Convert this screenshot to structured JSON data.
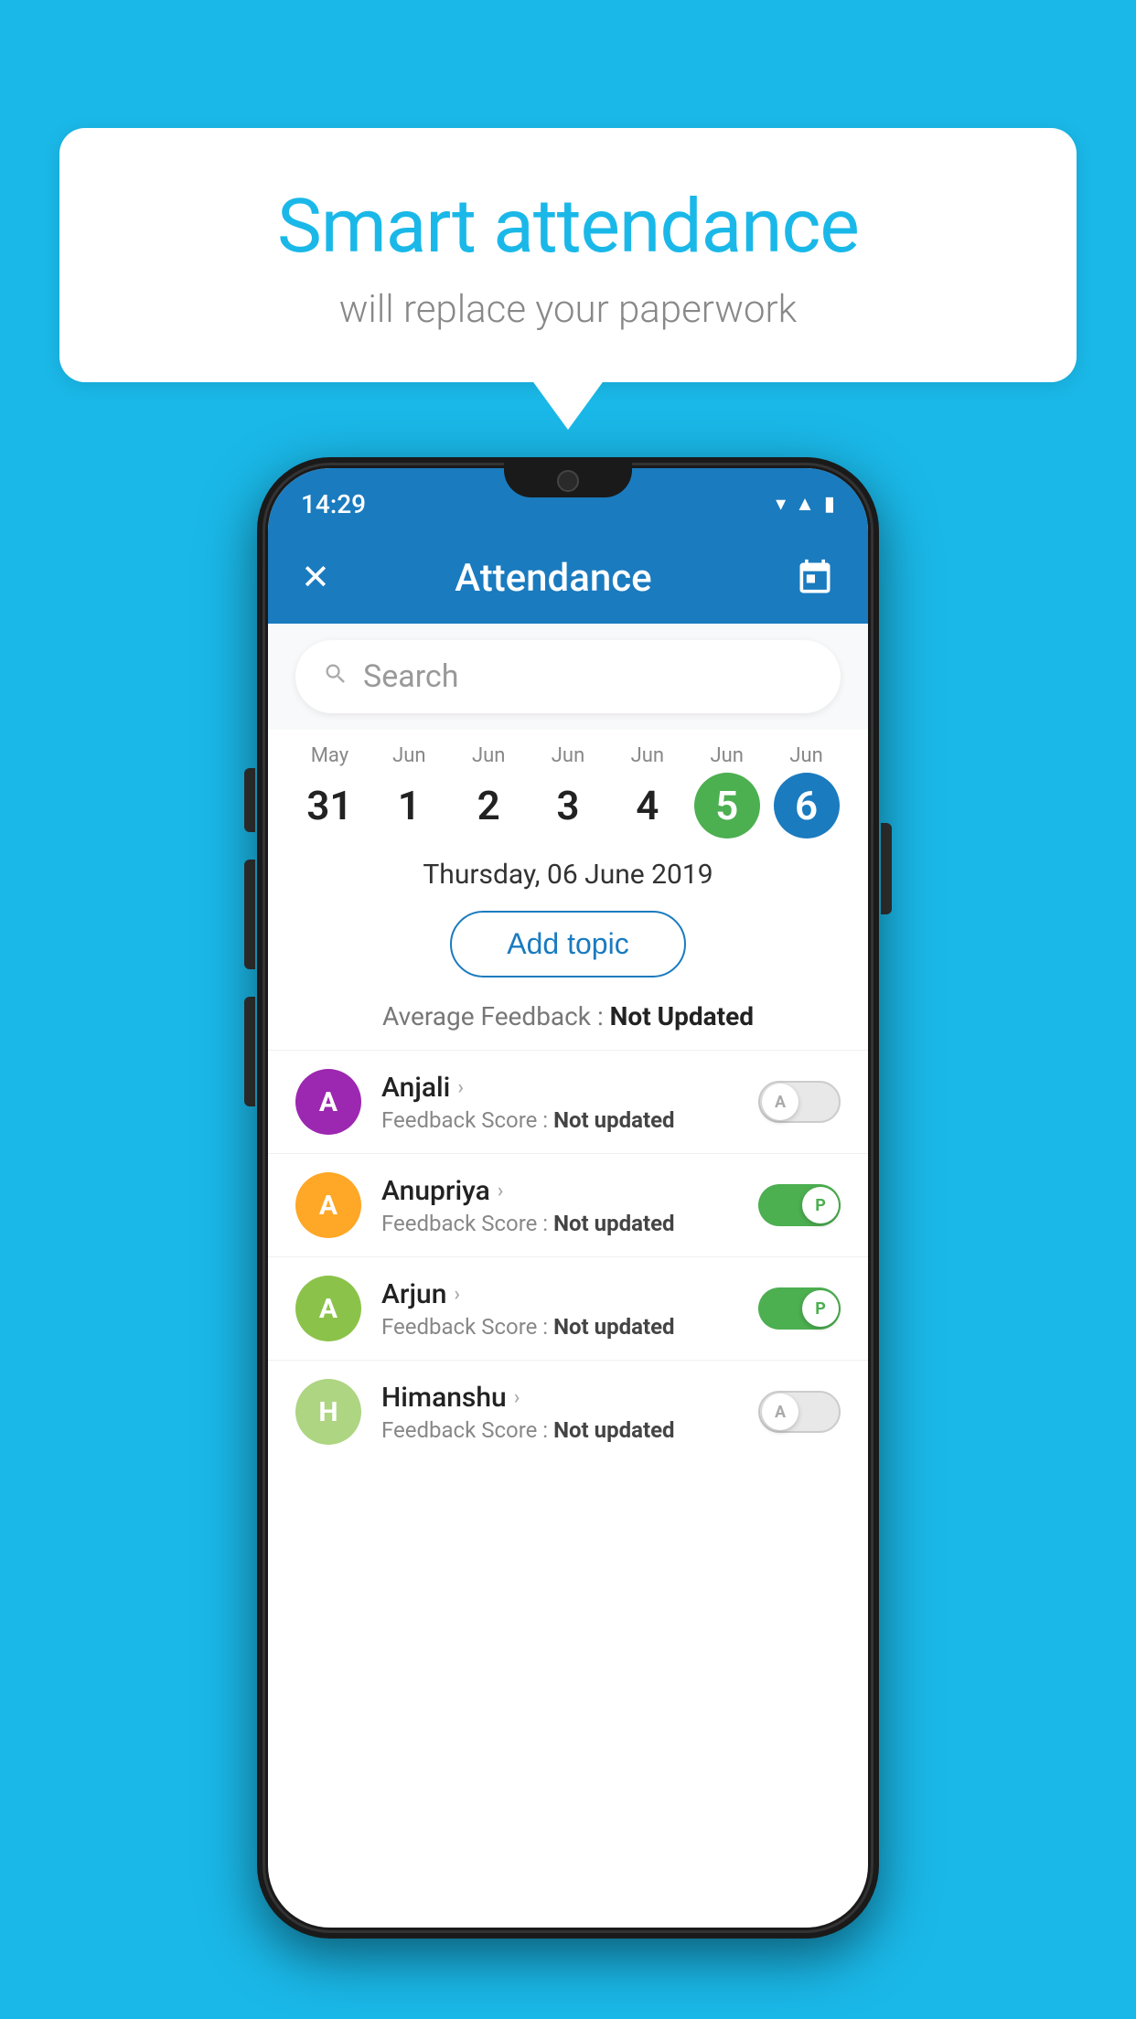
{
  "background": {
    "color": "#1ab8e8"
  },
  "bubble": {
    "title": "Smart attendance",
    "subtitle": "will replace your paperwork"
  },
  "status_bar": {
    "time": "14:29",
    "icons": [
      "wifi",
      "signal",
      "battery"
    ]
  },
  "app_bar": {
    "title": "Attendance",
    "close_label": "✕",
    "calendar_label": "📅"
  },
  "search": {
    "placeholder": "Search"
  },
  "calendar": {
    "days": [
      {
        "month": "May",
        "date": "31",
        "state": "normal"
      },
      {
        "month": "Jun",
        "date": "1",
        "state": "normal"
      },
      {
        "month": "Jun",
        "date": "2",
        "state": "normal"
      },
      {
        "month": "Jun",
        "date": "3",
        "state": "normal"
      },
      {
        "month": "Jun",
        "date": "4",
        "state": "normal"
      },
      {
        "month": "Jun",
        "date": "5",
        "state": "today"
      },
      {
        "month": "Jun",
        "date": "6",
        "state": "selected"
      }
    ]
  },
  "selected_date": "Thursday, 06 June 2019",
  "add_topic_label": "Add topic",
  "feedback_summary": {
    "label": "Average Feedback : ",
    "value": "Not Updated"
  },
  "students": [
    {
      "name": "Anjali",
      "avatar_letter": "A",
      "avatar_color": "#9c27b0",
      "feedback_label": "Feedback Score : ",
      "feedback_value": "Not updated",
      "status": "absent"
    },
    {
      "name": "Anupriya",
      "avatar_letter": "A",
      "avatar_color": "#ffa726",
      "feedback_label": "Feedback Score : ",
      "feedback_value": "Not updated",
      "status": "present"
    },
    {
      "name": "Arjun",
      "avatar_letter": "A",
      "avatar_color": "#8bc34a",
      "feedback_label": "Feedback Score : ",
      "feedback_value": "Not updated",
      "status": "present"
    },
    {
      "name": "Himanshu",
      "avatar_letter": "H",
      "avatar_color": "#aed581",
      "feedback_label": "Feedback Score : ",
      "feedback_value": "Not updated",
      "status": "absent"
    }
  ]
}
